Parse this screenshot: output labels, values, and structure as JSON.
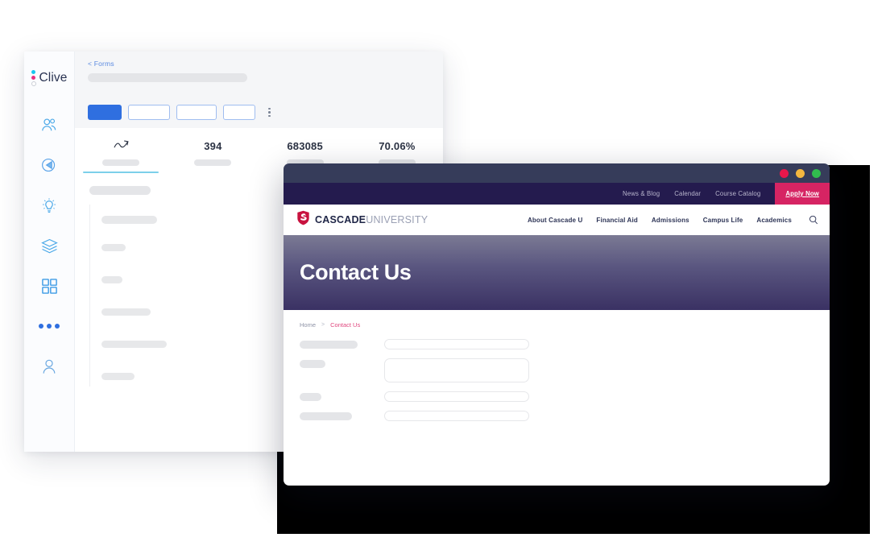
{
  "app": {
    "brand": "Clive",
    "breadcrumb_back": "< Forms",
    "sidebar_icons": [
      {
        "name": "users-icon",
        "label": "Audience"
      },
      {
        "name": "megaphone-icon",
        "label": "Campaigns"
      },
      {
        "name": "lightbulb-icon",
        "label": "Insights"
      },
      {
        "name": "layers-icon",
        "label": "Content"
      },
      {
        "name": "grid-icon",
        "label": "Apps"
      },
      {
        "name": "more-dots-icon",
        "label": "More"
      },
      {
        "name": "account-icon",
        "label": "Account"
      }
    ],
    "toolbar": {
      "buttons": [
        "",
        "",
        "",
        ""
      ],
      "kebab": "more-options"
    },
    "stats": [
      {
        "value": "",
        "icon": "trend-chart-icon",
        "active": true
      },
      {
        "value": "394",
        "icon": "",
        "active": false
      },
      {
        "value": "683085",
        "icon": "",
        "active": false
      },
      {
        "value": "70.06%",
        "icon": "",
        "active": false
      }
    ]
  },
  "browser": {
    "traffic_lights": [
      "close",
      "minimize",
      "maximize"
    ],
    "colors": {
      "close": "#e8174b",
      "minimize": "#f4b73f",
      "maximize": "#31bd4e",
      "titlebar": "#363c5a",
      "utility_bar": "#241b4e",
      "apply_now": "#d62463",
      "accent_pink": "#e0477e",
      "logo_navy": "#1e2546"
    }
  },
  "site": {
    "utility_nav": [
      "News & Blog",
      "Calendar",
      "Course Catalog"
    ],
    "apply_now": "Apply Now",
    "logo": {
      "bold": "CASCADE",
      "light": "UNIVERSITY",
      "icon": "shield-icon"
    },
    "main_nav": [
      "About Cascade U",
      "Financial Aid",
      "Admissions",
      "Campus Life",
      "Academics"
    ],
    "search_icon": "search-icon",
    "hero_title": "Contact Us",
    "breadcrumb": {
      "home": "Home",
      "separator": ">",
      "current": "Contact Us"
    }
  }
}
